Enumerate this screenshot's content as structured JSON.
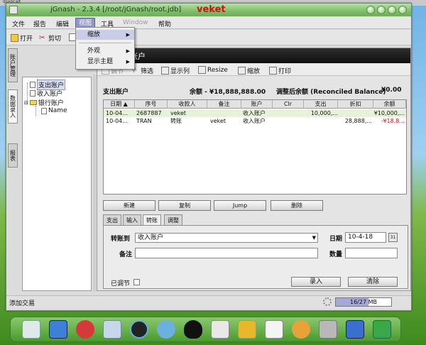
{
  "window": {
    "title": "jGnash - 2.3.4  [/root/jGnash/root.jdb]",
    "brand": "veket"
  },
  "menubar": {
    "items": [
      {
        "label": "文件",
        "state": "normal"
      },
      {
        "label": "报告",
        "state": "normal"
      },
      {
        "label": "编辑",
        "state": "normal"
      },
      {
        "label": "视图",
        "state": "active"
      },
      {
        "label": "工具",
        "state": "normal"
      },
      {
        "label": "Window",
        "state": "disabled"
      },
      {
        "label": "帮助",
        "state": "normal"
      }
    ]
  },
  "view_menu": {
    "items": [
      {
        "label": "缩放",
        "has_submenu": true,
        "highlighted": true
      },
      {
        "label": "外观",
        "has_submenu": true,
        "highlighted": false
      },
      {
        "label": "显示主题",
        "has_submenu": true,
        "highlighted": false
      }
    ]
  },
  "toolbar": {
    "open": "打开",
    "cut": "剪切"
  },
  "side_tabs": [
    "账户管理",
    "数据录入",
    "报表"
  ],
  "tree": {
    "items": [
      "支出账户",
      "收入账户",
      "银行账户",
      "Name"
    ]
  },
  "register": {
    "header_title": "登记账户",
    "tools": [
      "调节",
      "筛选",
      "显示列",
      "Resize",
      "缩放",
      "打印"
    ],
    "account_name": "支出账户",
    "balance_label": "余额 - ¥18,888,888.00",
    "reconciled_label": "调整后余额 (Reconciled Balance)",
    "reconciled_value": "¥0.00",
    "columns": [
      "日期 ▲",
      "序号",
      "收款人",
      "备注",
      "账户",
      "Clr",
      "支出",
      "折扣",
      "余额"
    ],
    "rows": [
      {
        "date": "10-04...",
        "num": "2687887",
        "payee": "veket",
        "memo": "",
        "account": "收入账户",
        "clr": "",
        "out": "10,000,...",
        "disc": "",
        "balance": "¥10,000,...",
        "balance_red": false
      },
      {
        "date": "10-04...",
        "num": "TRAN",
        "payee": "转账",
        "memo": "veket",
        "account": "收入账户",
        "clr": "",
        "out": "",
        "disc": "28,888,...",
        "balance": "-¥18,8...",
        "balance_red": true
      }
    ]
  },
  "actions": {
    "new": "新建",
    "copy": "复制",
    "jump": "Jump",
    "delete": "删除"
  },
  "form": {
    "tabs": [
      "支出",
      "输入",
      "转账",
      "调整"
    ],
    "active_tab": "转账",
    "transfer_label": "转账到",
    "transfer_value": "收入账户",
    "date_label": "日期",
    "date_value": "10-4-18",
    "memo_label": "备注",
    "memo_value": "",
    "quantity_label": "数量",
    "quantity_value": "",
    "reconciled_label": "已调节",
    "enter_button": "录入",
    "clear_button": "清除"
  },
  "status": {
    "text": "添加交易",
    "memory": "16/27 MB",
    "memory_fraction": 0.59
  },
  "colors": {
    "title_green": "#7fbf6a",
    "active_menu": "#8f98c4",
    "selected_row": "#e6f3da",
    "negative": "#d01010",
    "memory_fill": "#a5a9d9"
  }
}
